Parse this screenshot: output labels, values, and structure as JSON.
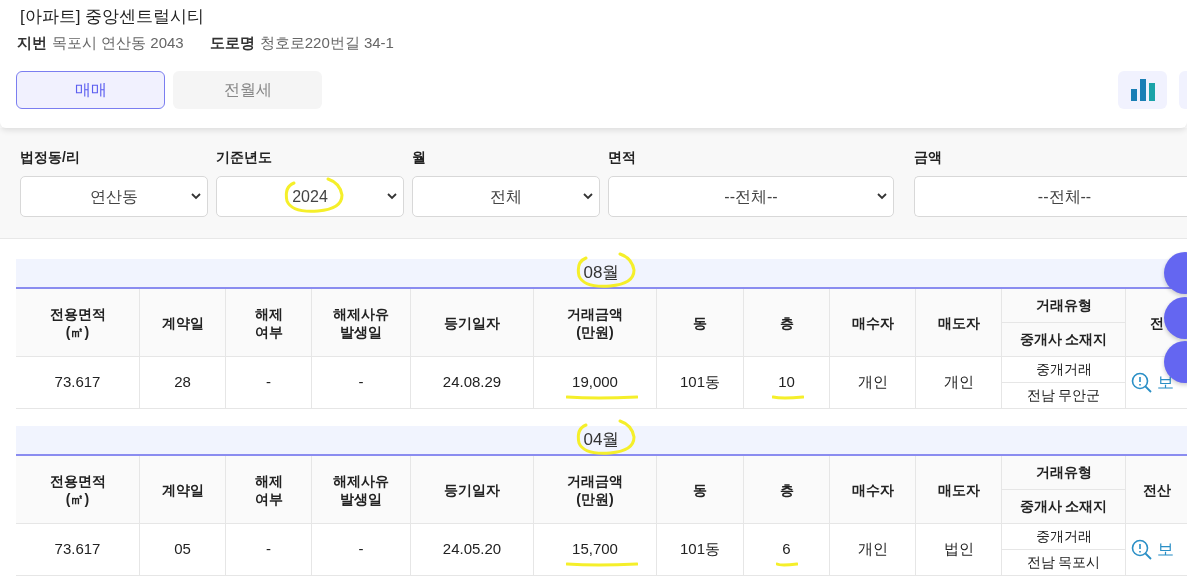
{
  "listing": {
    "title": "[아파트] 중앙센트럴시티",
    "address": [
      {
        "label": "지번",
        "value": "목포시 연산동 2043"
      },
      {
        "label": "도로명",
        "value": "청호로220번길 34-1"
      }
    ]
  },
  "tabs": [
    {
      "label": "매매",
      "selected": true
    },
    {
      "label": "전월세",
      "selected": false
    }
  ],
  "filters": [
    {
      "label": "법정동/리",
      "value": "연산동",
      "highlighted": false
    },
    {
      "label": "기준년도",
      "value": "2024",
      "highlighted": true
    },
    {
      "label": "월",
      "value": "전체",
      "highlighted": false
    },
    {
      "label": "면적",
      "value": "--전체--",
      "highlighted": false
    },
    {
      "label": "금액",
      "value": "--전체--",
      "highlighted": false
    }
  ],
  "months": [
    {
      "title": "08월",
      "highlighted": true,
      "columns": [
        {
          "label": "전용면적\n(㎡)"
        },
        {
          "label": "계약일"
        },
        {
          "label": "해제\n여부"
        },
        {
          "label": "해제사유\n발생일"
        },
        {
          "label": "등기일자"
        },
        {
          "label": "거래금액\n(만원)"
        },
        {
          "label": "동"
        },
        {
          "label": "층"
        },
        {
          "label": "매수자"
        },
        {
          "label": "매도자"
        },
        {
          "label": "거래유형",
          "sublabel": "중개사 소재지"
        },
        {
          "label": "전"
        }
      ],
      "rows": [
        {
          "cells": [
            {
              "text": "73.617",
              "highlighted": false
            },
            {
              "text": "28",
              "highlighted": false
            },
            {
              "text": "-",
              "highlighted": false
            },
            {
              "text": "-",
              "highlighted": false
            },
            {
              "text": "24.08.29",
              "highlighted": false
            },
            {
              "text": "19,000",
              "highlighted": true
            },
            {
              "text": "101동",
              "highlighted": false
            },
            {
              "text": "10",
              "highlighted": true
            },
            {
              "text": "개인",
              "highlighted": false
            },
            {
              "text": "개인",
              "highlighted": false
            },
            {
              "text": "중개거래",
              "subtext": "전남 무안군"
            },
            {
              "text": "보",
              "kind": "link"
            }
          ]
        }
      ]
    },
    {
      "title": "04월",
      "highlighted": true,
      "columns": [
        {
          "label": "전용면적\n(㎡)"
        },
        {
          "label": "계약일"
        },
        {
          "label": "해제\n여부"
        },
        {
          "label": "해제사유\n발생일"
        },
        {
          "label": "등기일자"
        },
        {
          "label": "거래금액\n(만원)"
        },
        {
          "label": "동"
        },
        {
          "label": "층"
        },
        {
          "label": "매수자"
        },
        {
          "label": "매도자"
        },
        {
          "label": "거래유형",
          "sublabel": "중개사 소재지"
        },
        {
          "label": "전산"
        }
      ],
      "rows": [
        {
          "cells": [
            {
              "text": "73.617",
              "highlighted": false
            },
            {
              "text": "05",
              "highlighted": false
            },
            {
              "text": "-",
              "highlighted": false
            },
            {
              "text": "-",
              "highlighted": false
            },
            {
              "text": "24.05.20",
              "highlighted": false
            },
            {
              "text": "15,700",
              "highlighted": true
            },
            {
              "text": "101동",
              "highlighted": false
            },
            {
              "text": "6",
              "highlighted": true
            },
            {
              "text": "개인",
              "highlighted": false
            },
            {
              "text": "법인",
              "highlighted": false
            },
            {
              "text": "중개거래",
              "subtext": "전남 목포시"
            },
            {
              "text": "보",
              "kind": "link"
            }
          ]
        }
      ]
    }
  ]
}
